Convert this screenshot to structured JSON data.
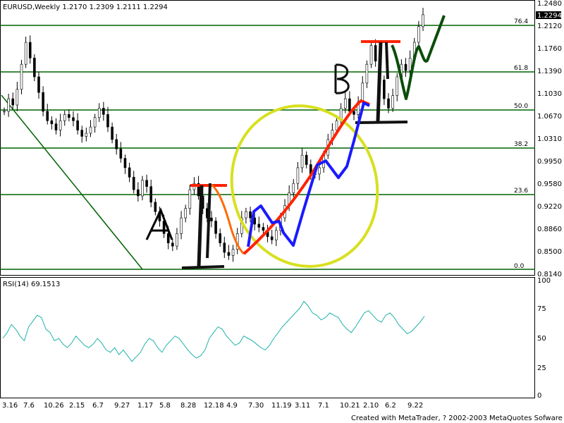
{
  "header": {
    "symbol_info": "EURUSD,Weekly  1.2170 1.2309 1.2111 1.2294",
    "current_price": "1.2294"
  },
  "price_axis": {
    "ticks": [
      "1.2480",
      "1.2120",
      "1.1760",
      "1.1390",
      "1.1030",
      "1.0670",
      "1.0310",
      "0.9950",
      "0.9580",
      "0.9220",
      "0.8860",
      "0.8500",
      "0.8140"
    ]
  },
  "fib_levels": [
    {
      "label": "76.4"
    },
    {
      "label": "61.8"
    },
    {
      "label": "50.0"
    },
    {
      "label": "38.2"
    },
    {
      "label": "23.6"
    },
    {
      "label": "0.0"
    }
  ],
  "annotations": {
    "label_a": "A",
    "label_b": "B"
  },
  "rsi": {
    "title": "RSI(14) 69.1513",
    "ticks": [
      "100",
      "75",
      "50",
      "25",
      "0"
    ]
  },
  "time_axis": {
    "labels": [
      "3.16",
      "7.6",
      "10.26",
      "2.15",
      "6.7",
      "9.27",
      "1.17",
      "5.8",
      "8.28",
      "12.18",
      "4.9",
      "7.30",
      "11.19",
      "3.11",
      "7.1",
      "10.21",
      "2.10",
      "6.2",
      "9.22"
    ]
  },
  "footer": "Created with MetaTrader, ? 2002-2003 MetaQuotes Sofware Corp.",
  "colors": {
    "candles": "#000000",
    "fib_lines": "#006400",
    "trendline": "#006400",
    "rsi_line": "#20B2AA",
    "red": "#ff2200",
    "blue": "#1a1aff",
    "yellow": "#d8e020",
    "orange": "#ff6a00",
    "darkgreen": "#0b4d0b"
  },
  "chart_data": [
    {
      "type": "line",
      "title": "EURUSD,Weekly",
      "chart": "candlestick price series (approximate weekly closes)",
      "y_ticks": [
        1.248,
        1.212,
        1.176,
        1.139,
        1.103,
        1.067,
        1.031,
        0.995,
        0.958,
        0.922,
        0.886,
        0.85,
        0.814
      ],
      "ylim": [
        0.814,
        1.248
      ],
      "x": [
        "3.16",
        "7.6",
        "10.26",
        "2.15",
        "6.7",
        "9.27",
        "1.17",
        "5.8",
        "8.28",
        "12.18",
        "4.9",
        "7.30",
        "11.19",
        "3.11",
        "7.1",
        "10.21",
        "2.10",
        "6.2",
        "9.22"
      ],
      "series": [
        {
          "values": [
            1.075,
            1.095,
            1.085,
            1.11,
            1.15,
            1.185,
            1.16,
            1.13,
            1.105,
            1.075,
            1.06,
            1.055,
            1.045,
            1.06,
            1.07,
            1.065,
            1.06,
            1.045,
            1.035,
            1.04,
            1.05,
            1.065,
            1.08,
            1.07,
            1.05,
            1.03,
            1.015,
            1.0,
            0.985,
            0.97,
            0.95,
            0.94,
            0.965,
            0.955,
            0.93,
            0.915,
            0.9,
            0.88,
            0.865,
            0.86,
            0.88,
            0.905,
            0.92,
            0.95,
            0.96,
            0.94,
            0.92,
            0.905,
            0.9,
            0.88,
            0.865,
            0.85,
            0.845,
            0.855,
            0.88,
            0.905,
            0.915,
            0.905,
            0.895,
            0.89,
            0.885,
            0.875,
            0.87,
            0.885,
            0.905,
            0.925,
            0.945,
            0.96,
            0.985,
            1.005,
            0.99,
            0.975,
            0.975,
            0.985,
            1.005,
            1.03,
            1.045,
            1.06,
            1.08,
            1.095,
            1.075,
            1.07,
            1.09,
            1.12,
            1.15,
            1.18,
            1.155,
            1.125,
            1.095,
            1.08,
            1.1,
            1.13,
            1.15,
            1.14,
            1.16,
            1.185,
            1.21,
            1.229
          ]
        }
      ],
      "annotations": [
        "0.0",
        "23.6",
        "38.2",
        "50.0",
        "61.8",
        "76.4",
        "A",
        "B"
      ]
    },
    {
      "type": "line",
      "title": "RSI(14) 69.1513",
      "y_ticks": [
        100,
        75,
        50,
        25,
        0
      ],
      "ylim": [
        0,
        100
      ],
      "series": [
        {
          "values": [
            50,
            55,
            62,
            58,
            52,
            48,
            60,
            65,
            70,
            68,
            58,
            55,
            48,
            50,
            45,
            42,
            46,
            52,
            48,
            44,
            42,
            45,
            50,
            46,
            40,
            38,
            42,
            36,
            40,
            35,
            30,
            34,
            38,
            45,
            50,
            48,
            42,
            38,
            44,
            48,
            52,
            50,
            45,
            40,
            36,
            33,
            35,
            40,
            50,
            55,
            60,
            58,
            52,
            48,
            44,
            46,
            52,
            50,
            48,
            45,
            42,
            40,
            44,
            50,
            55,
            60,
            64,
            68,
            72,
            76,
            82,
            78,
            72,
            70,
            66,
            68,
            72,
            70,
            68,
            62,
            58,
            55,
            60,
            66,
            72,
            74,
            70,
            66,
            64,
            70,
            72,
            68,
            62,
            58,
            54,
            56,
            60,
            64,
            69.15
          ]
        }
      ]
    }
  ]
}
